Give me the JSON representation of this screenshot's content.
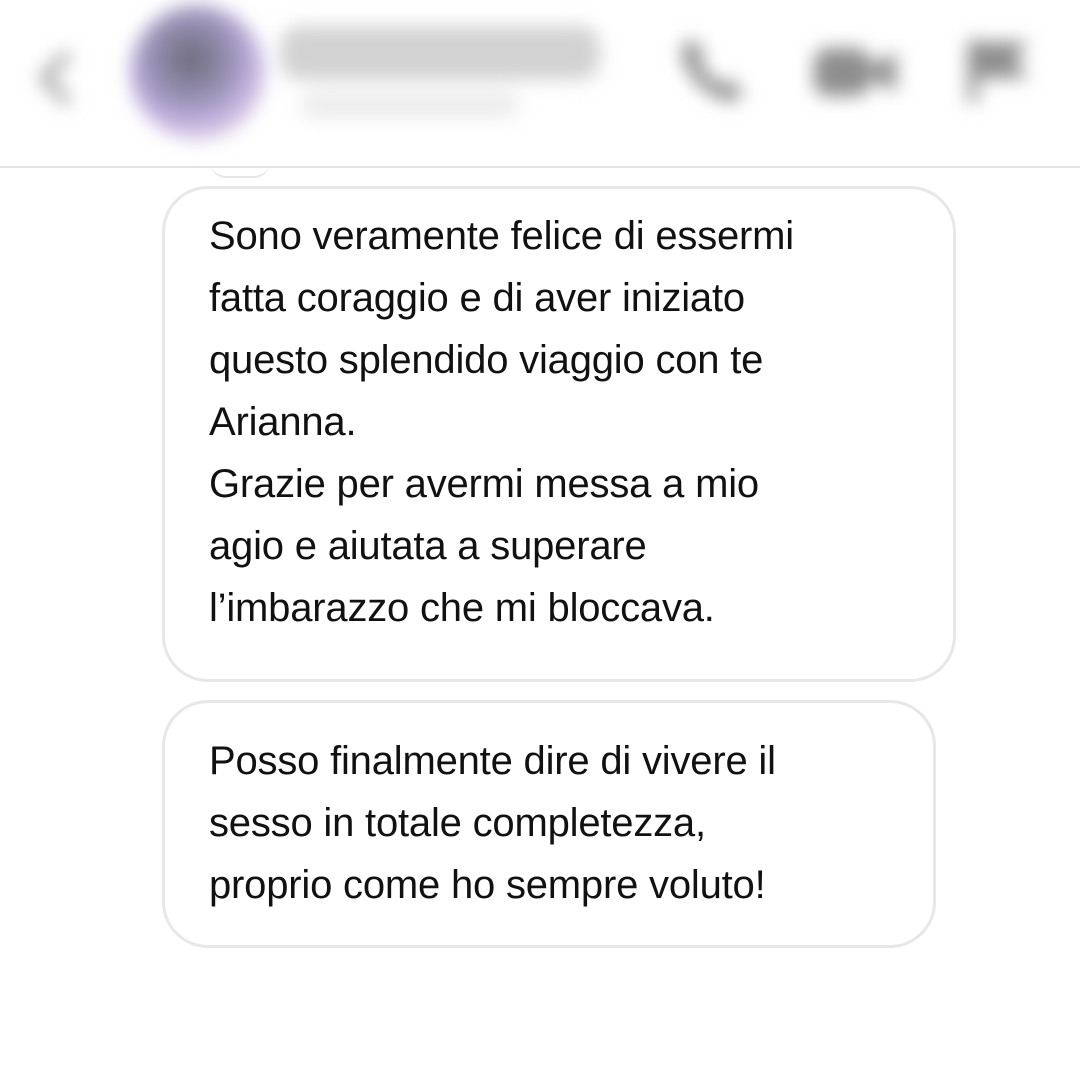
{
  "header": {
    "back_icon": "chevron-left-icon",
    "call_icon": "phone-icon",
    "video_icon": "video-camera-icon",
    "report_icon": "flag-icon"
  },
  "messages": [
    {
      "paragraphs": [
        {
          "lines": [
            "Sono veramente felice di essermi",
            "fatta coraggio e di aver iniziato",
            "questo splendido viaggio con te",
            "Arianna."
          ]
        },
        {
          "lines": [
            "Grazie per avermi messa a mio",
            "agio e aiutata a superare",
            "l’imbarazzo che mi bloccava."
          ]
        }
      ]
    },
    {
      "paragraphs": [
        {
          "lines": [
            "Posso finalmente dire di vivere il",
            "sesso in totale completezza,",
            "proprio come ho sempre voluto!"
          ]
        }
      ]
    }
  ],
  "colors": {
    "bubble_border": "#e7e7e7",
    "text": "#111111",
    "background": "#ffffff"
  }
}
